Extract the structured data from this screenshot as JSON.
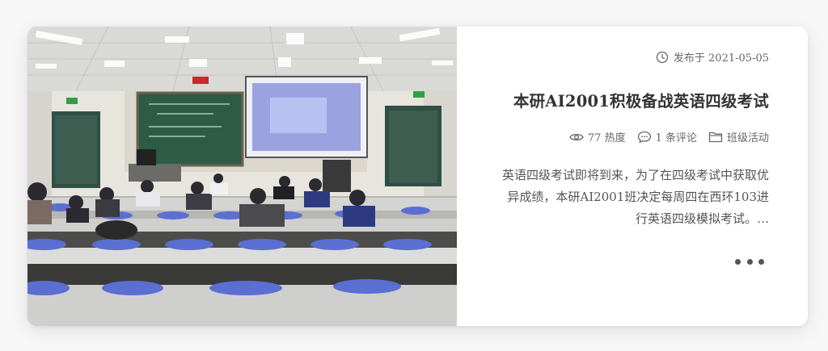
{
  "post": {
    "date_label": "发布于 2021-05-05",
    "title": "本研AI2001积极备战英语四级考试",
    "views": "77 热度",
    "comments": "1 条评论",
    "category": "班级活动",
    "excerpt": "英语四级考试即将到来，为了在四级考试中获取优异成绩，本研AI2001班决定每周四在西环103进行英语四级模拟考试。…",
    "image_alt": "classroom-exam-photo"
  },
  "colors": {
    "card_bg": "#ffffff",
    "text_title": "#333333",
    "text_meta": "#666666",
    "chalkboard": "#2e5b45",
    "chair_blue": "#5a6fd1"
  }
}
